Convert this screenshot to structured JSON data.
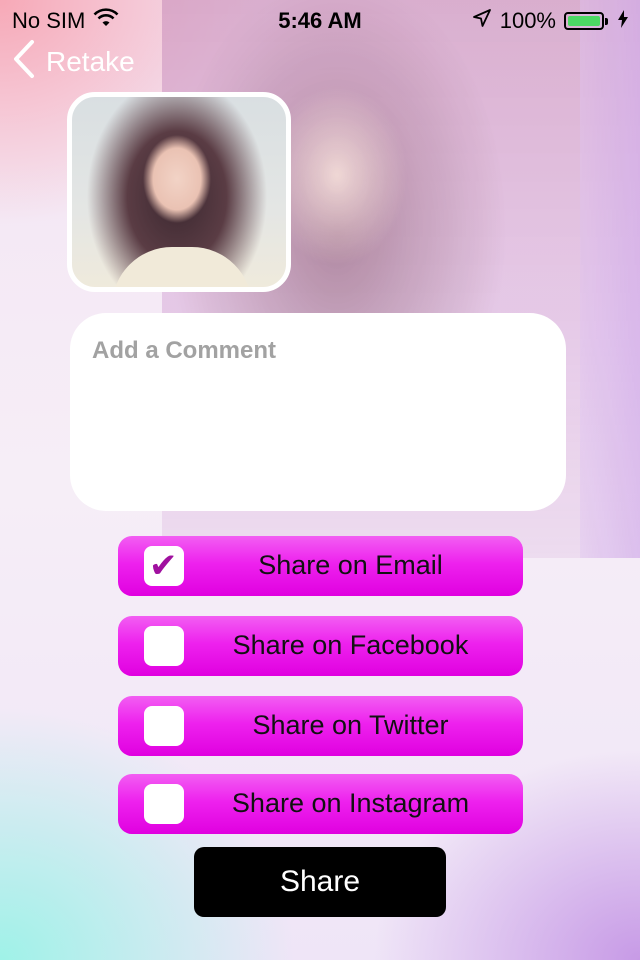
{
  "status_bar": {
    "carrier": "No SIM",
    "time": "5:46 AM",
    "battery": "100%",
    "icons": [
      "wifi-icon",
      "location-arrow-icon",
      "battery-icon",
      "charging-bolt-icon"
    ]
  },
  "nav": {
    "back_label": "Retake"
  },
  "comment": {
    "placeholder": "Add a Comment"
  },
  "share_options": [
    {
      "label": "Share on Email",
      "checked": true
    },
    {
      "label": "Share on Facebook",
      "checked": false
    },
    {
      "label": "Share on Twitter",
      "checked": false
    },
    {
      "label": "Share on Instagram",
      "checked": false
    }
  ],
  "share_button": {
    "label": "Share"
  },
  "colors": {
    "option_accent": "#ee22ee",
    "checkmark": "#a0109f",
    "share_button_bg": "#000000",
    "battery_fill": "#4cd964"
  }
}
